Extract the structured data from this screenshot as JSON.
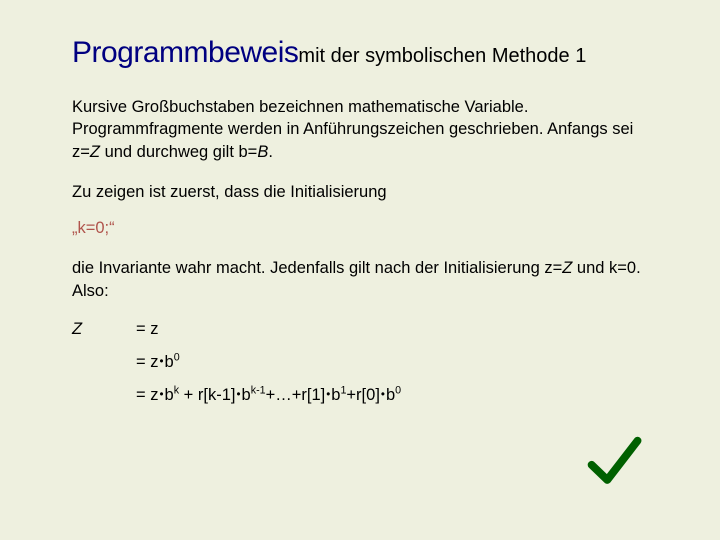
{
  "title": {
    "main": "Programmbeweis",
    "rest": " mit der symbolischen Methode 1"
  },
  "paragraphs": {
    "p1_a": "Kursive Großbuchstaben bezeichnen mathematische Variable. Programmfragmente werden in Anführungszeichen geschrieben. Anfangs sei z=",
    "p1_z": "Z",
    "p1_b": " und durchweg gilt b=",
    "p1_B": "B",
    "p1_c": ".",
    "p2": "Zu zeigen ist zuerst, dass die Initialisierung",
    "inv": "„k=0;“",
    "p3_a": "die Invariante wahr macht. Jedenfalls gilt nach der Initialisierung z=",
    "p3_z": "Z",
    "p3_b": " und k=0. Also:"
  },
  "eqs": {
    "lhs": "Z",
    "r1": "= z",
    "r2_a": "= z",
    "r2_b": "b",
    "r2_c": "0",
    "r3_a": "= z",
    "r3_b": "b",
    "r3_c": "k",
    "r3_d": " + r[k-1]",
    "r3_e": "b",
    "r3_f": "k-1",
    "r3_g": "+…+r[1]",
    "r3_h": "b",
    "r3_i": "1",
    "r3_j": "+r[0]",
    "r3_k": "b",
    "r3_l": "0"
  },
  "colors": {
    "bg": "#eef0df",
    "title": "#000080",
    "invariant": "#b0544c",
    "tick": "#006000"
  }
}
